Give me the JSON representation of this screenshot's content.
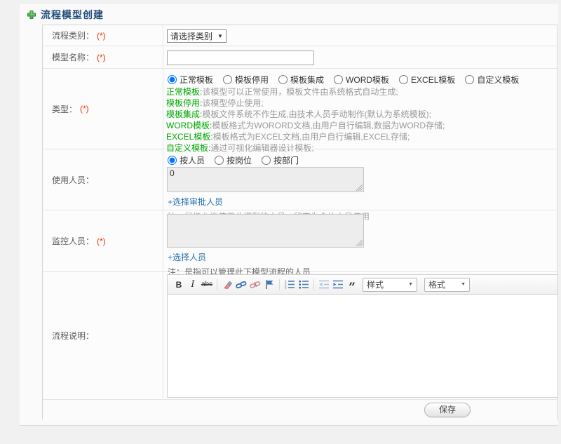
{
  "header": {
    "title": "流程模型创建",
    "icon": "plus-icon"
  },
  "form": {
    "required_marker": "(*)",
    "category": {
      "label": "流程类别：",
      "select_value": "请选择类别",
      "caret": "▼"
    },
    "model_name": {
      "label": "模型名称：",
      "value": ""
    },
    "type": {
      "label": "类型：",
      "options": [
        {
          "label": "正常模板",
          "checked": true
        },
        {
          "label": "模板停用",
          "checked": false
        },
        {
          "label": "模板集成",
          "checked": false
        },
        {
          "label": "WORD模板",
          "checked": false
        },
        {
          "label": "EXCEL模板",
          "checked": false
        },
        {
          "label": "自定义模板",
          "checked": false
        }
      ],
      "descriptions": [
        {
          "term": "正常模板:",
          "text": "该模型可以正常使用，模板文件由系统格式自动生成;"
        },
        {
          "term": "模板停用:",
          "text": "该模型停止使用;"
        },
        {
          "term": "模板集成:",
          "text": "模板文件系统不作生成,由技术人员手动制作(默认为系统模板);"
        },
        {
          "term": "WORD模板:",
          "text": "模板格式为WORORD文档,由用户自行编辑,数据为WORD存储;"
        },
        {
          "term": "EXCEL模板:",
          "text": "模板格式为EXCEL文档,由用户自行编辑,EXCEL存储;"
        },
        {
          "term": "自定义模板:",
          "text": "通过可视化编辑器设计模板;"
        }
      ]
    },
    "users": {
      "label": "使用人员：",
      "options": [
        {
          "label": "按人员",
          "checked": true
        },
        {
          "label": "按岗位",
          "checked": false
        },
        {
          "label": "按部门",
          "checked": false
        }
      ],
      "textarea_value": "0",
      "link": "+选择审批人员",
      "note": "注：是指允许使用此模型的人员，留空为全体人员使用"
    },
    "monitors": {
      "label": "监控人员：",
      "textarea_value": "",
      "link": "+选择人员",
      "note": "注：是指可以管理此下模型流程的人员"
    },
    "description": {
      "label": "流程说明：",
      "editor": {
        "bold": "B",
        "italic": "I",
        "strike": "abc",
        "quote": "”",
        "styles_dropdown": "样式",
        "format_dropdown": "格式",
        "caret": "▼",
        "icon_names": [
          "remove-format-icon",
          "link-icon",
          "unlink-icon",
          "anchor-flag-icon",
          "ordered-list-icon",
          "bullet-list-icon",
          "outdent-icon",
          "indent-icon",
          "blockquote-icon"
        ]
      }
    },
    "save_button": "保存"
  },
  "colors": {
    "title": "#234e7d",
    "required": "#f42b00",
    "term_green": "#00a800",
    "link_blue": "#2470b3",
    "note_gray": "#a3a3a3"
  }
}
